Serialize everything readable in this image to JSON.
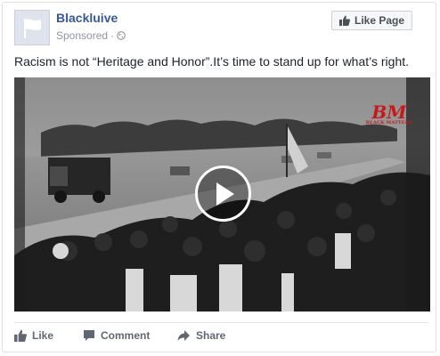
{
  "post": {
    "page_name": "Blackluive",
    "sponsored_label": "Sponsored",
    "dot_separator": "·",
    "like_page_label": "Like Page",
    "text": "Racism is not “Heritage and Honor”.It’s time to stand up for what’s right."
  },
  "video": {
    "watermark_logo": "BM",
    "watermark_text": "BLACK MATTERS"
  },
  "actions": {
    "like_label": "Like",
    "comment_label": "Comment",
    "share_label": "Share"
  },
  "colors": {
    "link_blue": "#365899",
    "meta_gray": "#90949c",
    "action_gray": "#616770"
  },
  "icons": [
    "flag-icon",
    "globe-icon",
    "thumbs-up-icon",
    "play-icon",
    "comment-icon",
    "share-icon"
  ]
}
